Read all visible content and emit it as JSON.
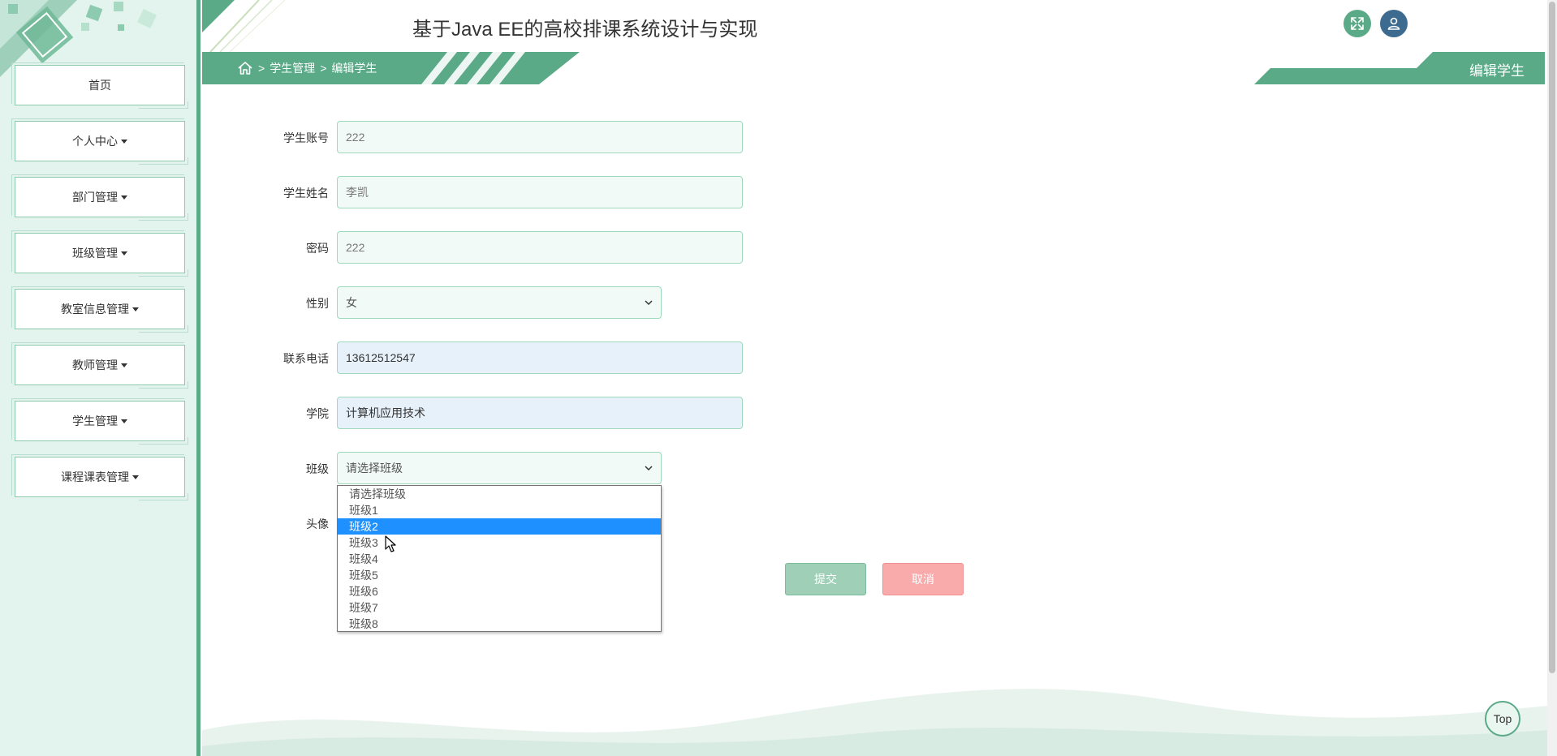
{
  "app": {
    "title": "基于Java EE的高校排课系统设计与实现"
  },
  "header": {
    "fullscreen_icon": "expand-icon",
    "user_icon": "user-icon",
    "accent": "#5aa987"
  },
  "breadcrumb": {
    "home_icon": "home-icon",
    "sep1": ">",
    "level1": "学生管理",
    "sep2": ">",
    "level2": "编辑学生"
  },
  "page_tag": "编辑学生",
  "sidebar": {
    "items": [
      {
        "label": "首页"
      },
      {
        "label": "个人中心"
      },
      {
        "label": "部门管理"
      },
      {
        "label": "班级管理"
      },
      {
        "label": "教室信息管理"
      },
      {
        "label": "教师管理"
      },
      {
        "label": "学生管理"
      },
      {
        "label": "课程课表管理"
      }
    ]
  },
  "form": {
    "account": {
      "label": "学生账号",
      "value": "222"
    },
    "name": {
      "label": "学生姓名",
      "value": "李凯"
    },
    "password": {
      "label": "密码",
      "value": "222"
    },
    "gender": {
      "label": "性别",
      "value": "女"
    },
    "phone": {
      "label": "联系电话",
      "value": "13612512547"
    },
    "college": {
      "label": "学院",
      "value": "计算机应用技术"
    },
    "class": {
      "label": "班级",
      "value": "请选择班级",
      "options": [
        "请选择班级",
        "班级1",
        "班级2",
        "班级3",
        "班级4",
        "班级5",
        "班级6",
        "班级7",
        "班级8"
      ],
      "highlighted": "班级2"
    },
    "avatar": {
      "label": "头像"
    }
  },
  "buttons": {
    "submit": "提交",
    "cancel": "取消"
  },
  "top_button": "Top"
}
